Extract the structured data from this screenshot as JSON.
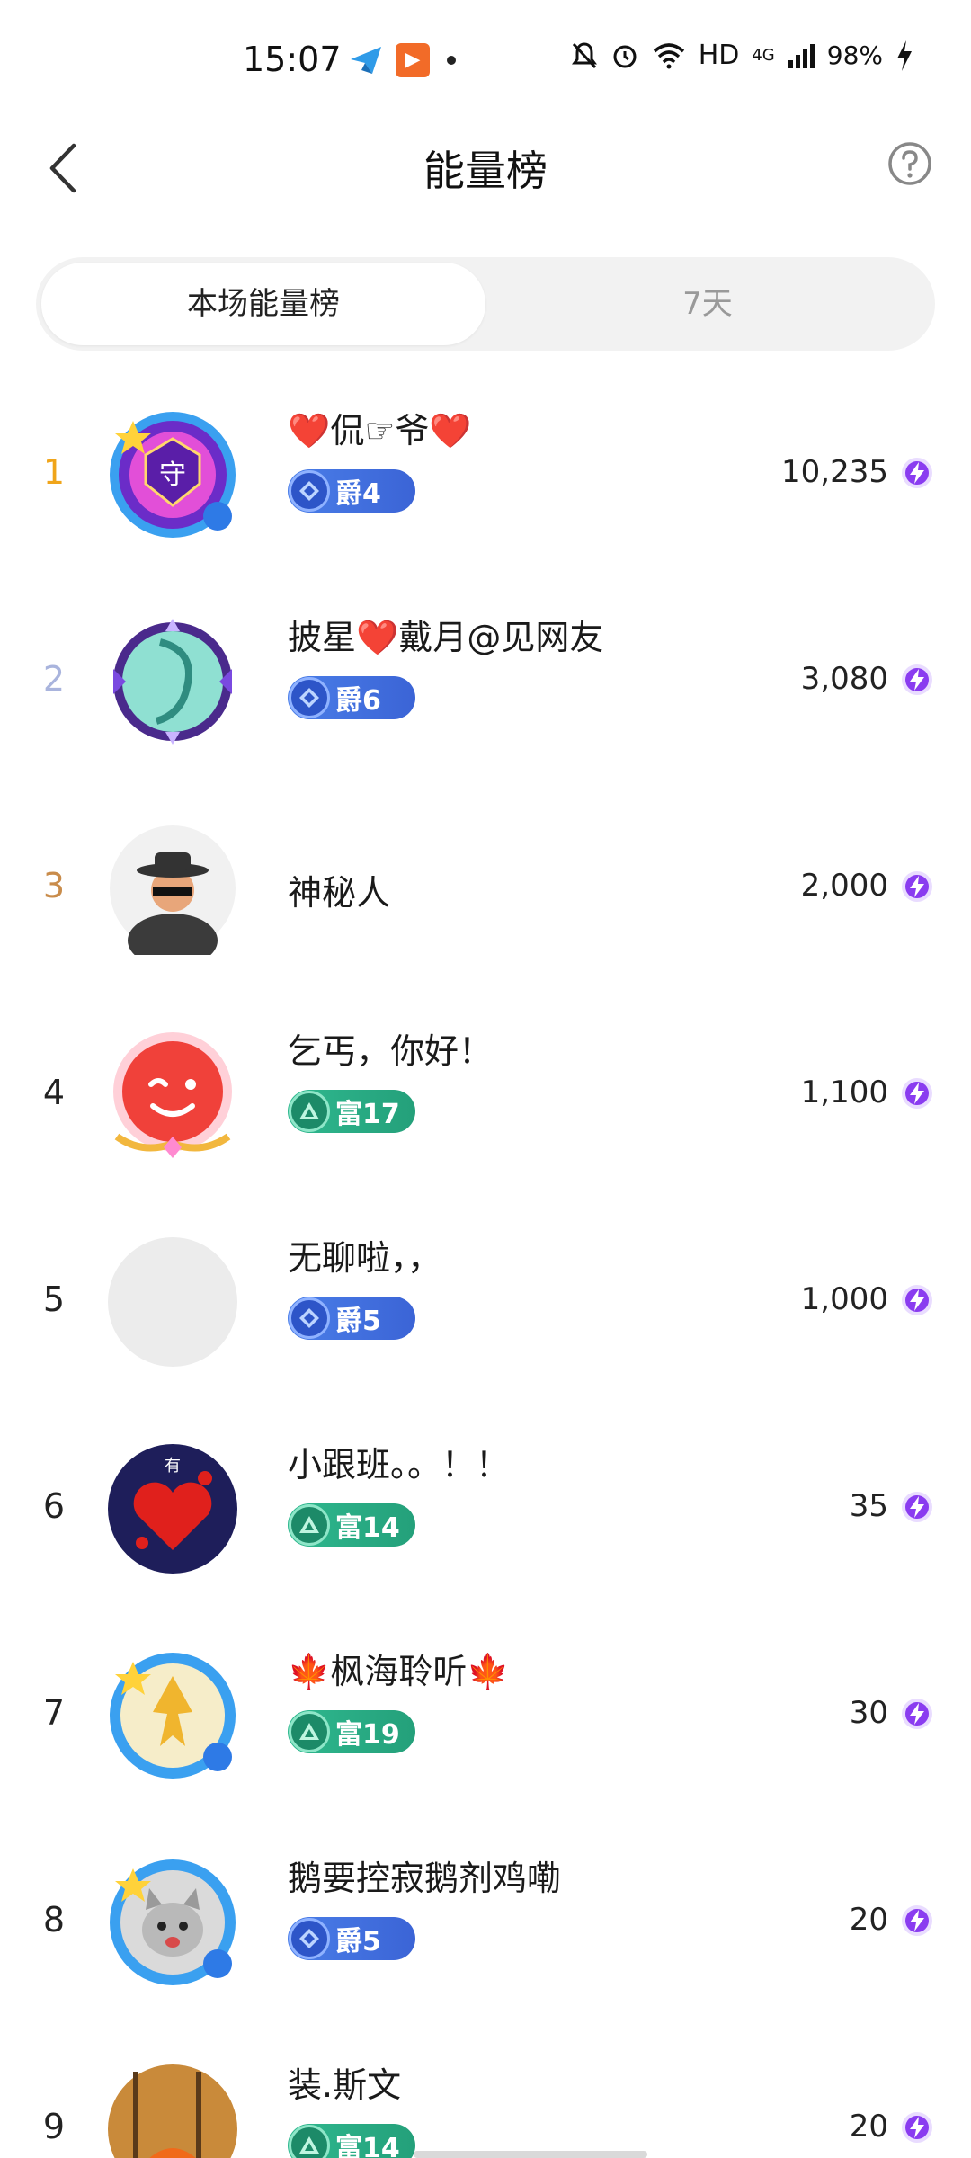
{
  "status_bar": {
    "time": "15:07",
    "network": "HD",
    "signal": "4G",
    "battery": "98%"
  },
  "header": {
    "title": "能量榜",
    "back_icon": "chevron-left-icon",
    "help_icon": "question-circle-icon"
  },
  "tabs": [
    {
      "label": "本场能量榜",
      "active": true
    },
    {
      "label": "7天",
      "active": false
    }
  ],
  "colors": {
    "rank1": "#f0a51a",
    "rank2": "#a9b4dd",
    "rank3": "#c98c4b",
    "rank_default": "#222222",
    "energy_icon": "#8a3cf0"
  },
  "leaderboard": [
    {
      "rank": "1",
      "name": "❤️侃☞爷❤️",
      "badge": "爵4",
      "badge_type": "jue",
      "score": "10,235"
    },
    {
      "rank": "2",
      "name": "披星❤️戴月@见网友",
      "badge": "爵6",
      "badge_type": "jue",
      "score": "3,080"
    },
    {
      "rank": "3",
      "name": "神秘人",
      "badge": "",
      "badge_type": "",
      "score": "2,000"
    },
    {
      "rank": "4",
      "name": "乞丐，你好！",
      "badge": "富17",
      "badge_type": "fu",
      "score": "1,100"
    },
    {
      "rank": "5",
      "name": "无聊啦，，",
      "badge": "爵5",
      "badge_type": "jue",
      "score": "1,000"
    },
    {
      "rank": "6",
      "name": "小跟班。。！！",
      "badge": "富14",
      "badge_type": "fu",
      "score": "35"
    },
    {
      "rank": "7",
      "name": "🍁枫海聆听🍁",
      "badge": "富19",
      "badge_type": "fu",
      "score": "30"
    },
    {
      "rank": "8",
      "name": "鹅要控寂鹅剂鸡嘞",
      "badge": "爵5",
      "badge_type": "jue",
      "score": "20"
    },
    {
      "rank": "9",
      "name": "装.斯文",
      "badge": "富14",
      "badge_type": "fu",
      "score": "20"
    }
  ]
}
